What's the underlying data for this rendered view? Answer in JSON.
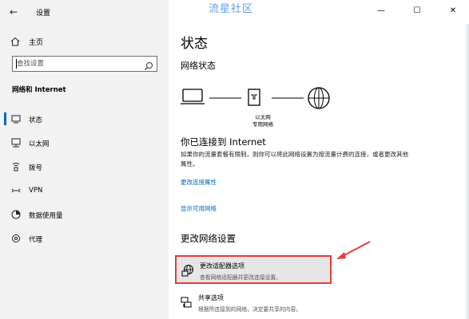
{
  "window": {
    "title": "设置",
    "watermark": "流星社区",
    "controls": {
      "minimize": "—",
      "maximize": "☐",
      "close": "✕"
    }
  },
  "sidebar": {
    "back_glyph": "←",
    "home_label": "主页",
    "search_placeholder": "查找设置",
    "section_title": "网络和 Internet",
    "items": [
      {
        "label": "状态",
        "icon": "status-icon",
        "selected": true
      },
      {
        "label": "以太网",
        "icon": "ethernet-icon",
        "selected": false
      },
      {
        "label": "拨号",
        "icon": "dialup-icon",
        "selected": false
      },
      {
        "label": "VPN",
        "icon": "vpn-icon",
        "selected": false
      },
      {
        "label": "数据使用量",
        "icon": "data-usage-icon",
        "selected": false
      },
      {
        "label": "代理",
        "icon": "proxy-icon",
        "selected": false
      }
    ]
  },
  "main": {
    "title": "状态",
    "network_status_heading": "网络状态",
    "diagram": {
      "adapter_name": "以太网",
      "network_name": "专用网络"
    },
    "connected_heading": "你已连接到 Internet",
    "connected_desc": "如果你的流量套餐有限制，则你可以将此网络设置为按流量计费的连接，或者更改其他属性。",
    "link_change_props": "更改连接属性",
    "link_show_networks": "显示可用网络",
    "change_settings_heading": "更改网络设置",
    "options": [
      {
        "title": "更改适配器选项",
        "desc": "查看网络适配器并更改连接设置。",
        "icon": "adapter-icon",
        "highlighted": true
      },
      {
        "title": "共享选项",
        "desc": "根据所连接到的网络，决定要共享的内容。",
        "icon": "sharing-icon",
        "highlighted": false
      }
    ]
  },
  "colors": {
    "accent": "#0067c0",
    "highlight_border": "#e83a3a",
    "sidebar_bg": "#f2f2f2"
  }
}
